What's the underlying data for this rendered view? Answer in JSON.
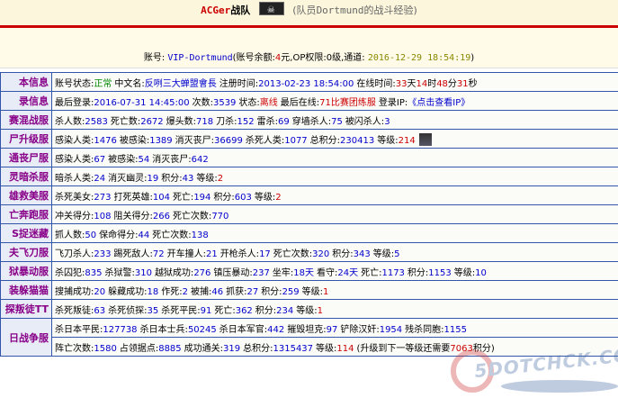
{
  "header": {
    "team_name": "ACGer",
    "team_suffix": "战队",
    "member_prefix": "(队员",
    "member_name": "Dortmund",
    "member_suffix": "的战斗经验)"
  },
  "account": {
    "label": "账号:",
    "name": "VIP-Dortmund",
    "balance_prefix": "(账号余额:",
    "balance_value": "4",
    "balance_unit": "元,OP权限:",
    "op_level": "0级,通道:",
    "time": "2016-12-29 18:54:19",
    "close": ")"
  },
  "rows": [
    {
      "label": "本信息",
      "text_1": "账号状态:",
      "status": "正常",
      "text_2": "中文名:",
      "cn_name": "反咧三大蝉盟會長",
      "text_3": "注册时间:",
      "reg_time": "2013-02-23 18:54:00",
      "text_4": "在线时间:",
      "days": "33",
      "days_u": "天",
      "hours": "14",
      "hours_u": "时",
      "mins": "48",
      "mins_u": "分",
      "secs": "31",
      "secs_u": "秒"
    },
    {
      "label": "录信息",
      "text_1": "最后登录:",
      "last_login": "2016-07-31 14:45:00",
      "text_2": "次数:",
      "count": "3539",
      "text_3": "状态:",
      "state": "离线",
      "text_4": "最后在线:",
      "last_server": "71比赛团练服",
      "text_5": "登录IP:",
      "ip_link": "《点击查看IP》"
    },
    {
      "label": "赛混战服",
      "parts": [
        {
          "k": "杀人数:",
          "v": "2583"
        },
        {
          "k": "死亡数:",
          "v": "2672"
        },
        {
          "k": "爆头数:",
          "v": "718"
        },
        {
          "k": "刀杀:",
          "v": "152"
        },
        {
          "k": "雷杀:",
          "v": "69"
        },
        {
          "k": "穿墙杀人:",
          "v": "75"
        },
        {
          "k": "被闪杀人:",
          "v": "3"
        }
      ]
    },
    {
      "label": "尸升级服",
      "parts": [
        {
          "k": "感染人类:",
          "v": "1476"
        },
        {
          "k": "被感染:",
          "v": "1389"
        },
        {
          "k": "消灭丧尸:",
          "v": "36699"
        },
        {
          "k": "杀死人类:",
          "v": "1077"
        },
        {
          "k": "总积分:",
          "v": "230413"
        }
      ],
      "level_label": "等级:",
      "level": "214"
    },
    {
      "label": "通丧尸服",
      "parts": [
        {
          "k": "感染人类:",
          "v": "67"
        },
        {
          "k": "被感染:",
          "v": "54"
        },
        {
          "k": "消灭丧尸:",
          "v": "642"
        }
      ]
    },
    {
      "label": "灵暗杀服",
      "parts": [
        {
          "k": "暗杀人类:",
          "v": "24"
        },
        {
          "k": "消灭幽灵:",
          "v": "19"
        },
        {
          "k": "积分:",
          "v": "43"
        }
      ],
      "level_label": "等级:",
      "level": "2"
    },
    {
      "label": "雄救美服",
      "parts": [
        {
          "k": "杀死美女:",
          "v": "273"
        },
        {
          "k": "打死英雄:",
          "v": "104"
        },
        {
          "k": "死亡:",
          "v": "194"
        },
        {
          "k": "积分:",
          "v": "603"
        }
      ],
      "level_label": "等级:",
      "level": "2"
    },
    {
      "label": "亡奔跑服",
      "parts": [
        {
          "k": "冲关得分:",
          "v": "108"
        },
        {
          "k": "阻关得分:",
          "v": "266"
        },
        {
          "k": "死亡次数:",
          "v": "770"
        }
      ]
    },
    {
      "label": "S捉迷藏",
      "parts": [
        {
          "k": "抓人数:",
          "v": "50"
        },
        {
          "k": "保命得分:",
          "v": "44"
        },
        {
          "k": "死亡次数:",
          "v": "138"
        }
      ]
    },
    {
      "label": "夫飞刀服",
      "parts": [
        {
          "k": "飞刀杀人:",
          "v": "233"
        },
        {
          "k": "踢死敌人:",
          "v": "72"
        },
        {
          "k": "开车撞人:",
          "v": "21"
        },
        {
          "k": "开枪杀人:",
          "v": "17"
        },
        {
          "k": "死亡次数:",
          "v": "320"
        },
        {
          "k": "积分:",
          "v": "343"
        },
        {
          "k": "等级:",
          "v": "5"
        }
      ]
    },
    {
      "label": "狱暴动服",
      "parts": [
        {
          "k": "杀囚犯:",
          "v": "835"
        },
        {
          "k": "杀狱警:",
          "v": "310"
        },
        {
          "k": "越狱成功:",
          "v": "276"
        },
        {
          "k": "镇压暴动:",
          "v": "237"
        },
        {
          "k": "坐牢:",
          "v": "18天"
        },
        {
          "k": "看守:",
          "v": "24天"
        },
        {
          "k": "死亡:",
          "v": "1173"
        },
        {
          "k": "积分:",
          "v": "1153"
        },
        {
          "k": "等级:",
          "v": "10"
        }
      ]
    },
    {
      "label": "装躲猫猫",
      "parts": [
        {
          "k": "搜捕成功:",
          "v": "20"
        },
        {
          "k": "躲藏成功:",
          "v": "18"
        },
        {
          "k": "作死:",
          "v": "2"
        },
        {
          "k": "被捕:",
          "v": "46"
        },
        {
          "k": "抓获:",
          "v": "27"
        },
        {
          "k": "积分:",
          "v": "259"
        }
      ],
      "level_label": "等级:",
      "level": "1"
    },
    {
      "label": "探叛徒TT",
      "parts": [
        {
          "k": "杀死叛徒:",
          "v": "63"
        },
        {
          "k": "杀死侦探:",
          "v": "35"
        },
        {
          "k": "杀死平民:",
          "v": "91"
        },
        {
          "k": "死亡:",
          "v": "362"
        },
        {
          "k": "积分:",
          "v": "234"
        }
      ],
      "level_label": "等级:",
      "level": "1"
    },
    {
      "label": "日战争服",
      "line_1": [
        {
          "k": "杀日本平民:",
          "v": "127738"
        },
        {
          "k": "杀日本士兵:",
          "v": "50245"
        },
        {
          "k": "杀日本军官:",
          "v": "442"
        },
        {
          "k": "摧毁坦克:",
          "v": "97"
        },
        {
          "k": "铲除汉奸:",
          "v": "1954"
        },
        {
          "k": "残杀同胞:",
          "v": "1155"
        }
      ],
      "line_2": [
        {
          "k": "阵亡次数:",
          "v": "1580"
        },
        {
          "k": "占领据点:",
          "v": "8885"
        },
        {
          "k": "成功通关:",
          "v": "319"
        },
        {
          "k": "总积分:",
          "v": "1315437"
        }
      ],
      "level_label": "等级:",
      "level": "114",
      "upgrade_prefix": "(升级到下一等级还需要",
      "upgrade_value": "7063",
      "upgrade_suffix": "积分)"
    }
  ],
  "watermark": {
    "text": "5DOTCHCK.COM"
  }
}
